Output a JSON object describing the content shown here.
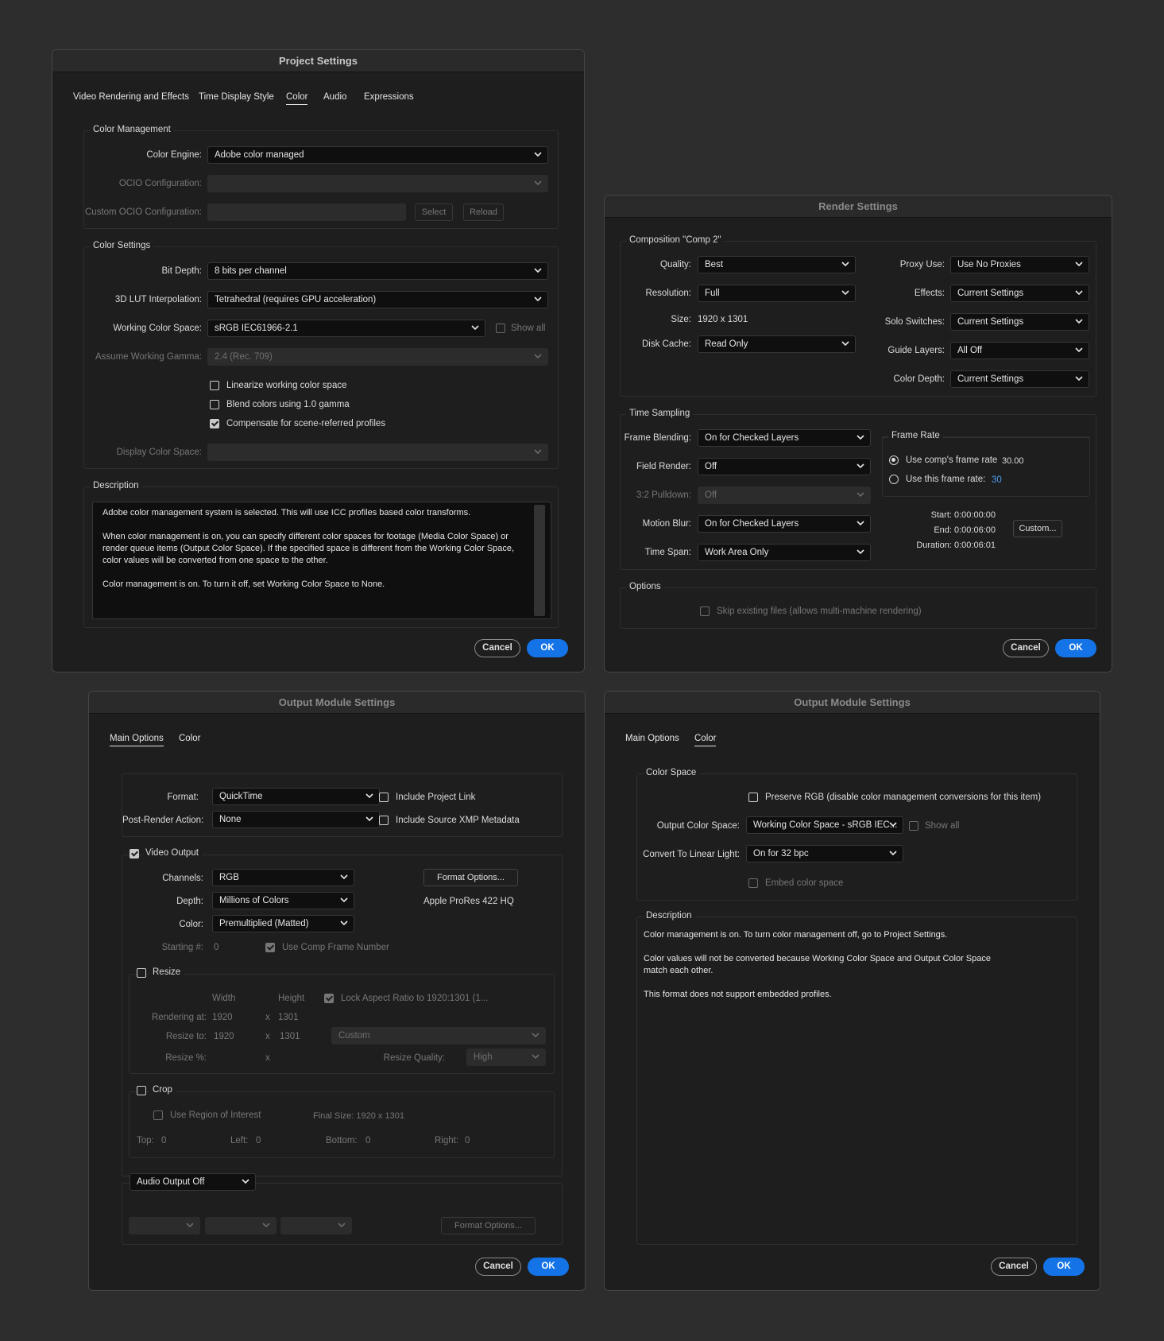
{
  "project": {
    "title": "Project Settings",
    "tabs": [
      "Video Rendering and Effects",
      "Time Display Style",
      "Color",
      "Audio",
      "Expressions"
    ],
    "color_management": {
      "label": "Color Management",
      "color_engine_label": "Color Engine:",
      "color_engine_value": "Adobe color managed",
      "ocio_label": "OCIO Configuration:",
      "custom_ocio_label": "Custom OCIO Configuration:",
      "select_label": "Select",
      "reload_label": "Reload"
    },
    "color_settings": {
      "label": "Color Settings",
      "bit_depth_label": "Bit Depth:",
      "bit_depth_value": "8 bits per channel",
      "lut_label": "3D LUT Interpolation:",
      "lut_value": "Tetrahedral (requires GPU acceleration)",
      "wcs_label": "Working Color Space:",
      "wcs_value": "sRGB IEC61966-2.1",
      "show_all_label": "Show all",
      "gamma_label": "Assume Working Gamma:",
      "gamma_value": "2.4 (Rec. 709)",
      "linearize_label": "Linearize working color space",
      "blend_label": "Blend colors using 1.0 gamma",
      "compensate_label": "Compensate for scene-referred profiles",
      "display_cs_label": "Display Color Space:"
    },
    "description": {
      "label": "Description",
      "text": "Adobe color management system is selected. This will use ICC profiles based color transforms.\n\nWhen color management is on, you can specify different color spaces for footage (Media Color Space) or\nrender queue items (Output Color Space). If the specified space is different from the Working Color Space,\ncolor values will be converted from one space to the other.\n\nColor management is on. To turn it off, set Working Color Space to None."
    },
    "cancel_label": "Cancel",
    "ok_label": "OK"
  },
  "render": {
    "title": "Render Settings",
    "comp_label": "Composition \"Comp 2\"",
    "quality_label": "Quality:",
    "quality_value": "Best",
    "resolution_label": "Resolution:",
    "resolution_value": "Full",
    "size_label": "Size:",
    "size_value": "1920 x 1301",
    "disk_cache_label": "Disk Cache:",
    "disk_cache_value": "Read Only",
    "proxy_label": "Proxy Use:",
    "proxy_value": "Use No Proxies",
    "effects_label": "Effects:",
    "effects_value": "Current Settings",
    "solo_label": "Solo Switches:",
    "solo_value": "Current Settings",
    "guide_label": "Guide Layers:",
    "guide_value": "All Off",
    "color_depth_label": "Color Depth:",
    "color_depth_value": "Current Settings",
    "time_sampling_label": "Time Sampling",
    "frame_blending_label": "Frame Blending:",
    "frame_blending_value": "On for Checked Layers",
    "field_render_label": "Field Render:",
    "field_render_value": "Off",
    "pulldown_label": "3:2 Pulldown:",
    "pulldown_value": "Off",
    "motion_blur_label": "Motion Blur:",
    "motion_blur_value": "On for Checked Layers",
    "time_span_label": "Time Span:",
    "time_span_value": "Work Area Only",
    "frame_rate_label": "Frame Rate",
    "use_comp_rate_label": "Use comp's frame rate",
    "comp_rate_value": "30.00",
    "use_this_rate_label": "Use this frame rate:",
    "this_rate_value": "30",
    "start_text": "Start: 0:00:00:00",
    "end_text": "End: 0:00:06:00",
    "duration_text": "Duration: 0:00:06:01",
    "custom_label": "Custom...",
    "options_label": "Options",
    "skip_label": "Skip existing files (allows multi-machine rendering)",
    "cancel_label": "Cancel",
    "ok_label": "OK"
  },
  "om_main": {
    "title": "Output Module Settings",
    "tabs": [
      "Main Options",
      "Color"
    ],
    "format_label": "Format:",
    "format_value": "QuickTime",
    "post_render_label": "Post-Render Action:",
    "post_render_value": "None",
    "include_link_label": "Include Project Link",
    "include_xmp_label": "Include Source XMP Metadata",
    "video_output_label": "Video Output",
    "channels_label": "Channels:",
    "channels_value": "RGB",
    "depth_label": "Depth:",
    "depth_value": "Millions of Colors",
    "color_label": "Color:",
    "color_value": "Premultiplied (Matted)",
    "format_options_label": "Format Options...",
    "codec_text": "Apple ProRes 422 HQ",
    "starting_label": "Starting #:",
    "starting_value": "0",
    "use_comp_frame_label": "Use Comp Frame Number",
    "resize_label": "Resize",
    "width_label": "Width",
    "height_label": "Height",
    "lock_label": "Lock Aspect Ratio to 1920:1301 (1...",
    "rendering_at_label": "Rendering at:",
    "rendering_w": "1920",
    "x1": "x",
    "rendering_h": "1301",
    "resize_to_label": "Resize to:",
    "resize_w": "1920",
    "x2": "x",
    "resize_h": "1301",
    "resize_preset": "Custom",
    "resize_pct_label": "Resize %:",
    "x3": "x",
    "resize_quality_label": "Resize Quality:",
    "resize_quality_value": "High",
    "crop_label": "Crop",
    "roi_label": "Use Region of Interest",
    "final_size_text": "Final Size: 1920 x 1301",
    "top_label": "Top:",
    "top_value": "0",
    "left_label": "Left:",
    "left_value": "0",
    "bottom_label": "Bottom:",
    "bottom_value": "0",
    "right_label": "Right:",
    "right_value": "0",
    "audio_value": "Audio Output Off",
    "audio_format_options_label": "Format Options...",
    "cancel_label": "Cancel",
    "ok_label": "OK"
  },
  "om_color": {
    "title": "Output Module Settings",
    "tabs": [
      "Main Options",
      "Color"
    ],
    "color_space_label": "Color Space",
    "preserve_label": "Preserve RGB (disable color management conversions for this item)",
    "ocs_label": "Output Color Space:",
    "ocs_value": "Working Color Space - sRGB IEC...",
    "show_all_label": "Show all",
    "linear_label": "Convert To Linear Light:",
    "linear_value": "On for 32 bpc",
    "embed_label": "Embed color space",
    "description_label": "Description",
    "description_text": "Color management is on. To turn color management off, go to Project Settings.\n\nColor values will not be converted because Working Color Space and Output Color Space\nmatch each other.\n\nThis format does not support embedded profiles.",
    "cancel_label": "Cancel",
    "ok_label": "OK"
  },
  "colors": {
    "background": "#2d2d2d",
    "dialog": "#1e1e1e",
    "accent": "#1473e6",
    "link": "#4a9bf0"
  }
}
